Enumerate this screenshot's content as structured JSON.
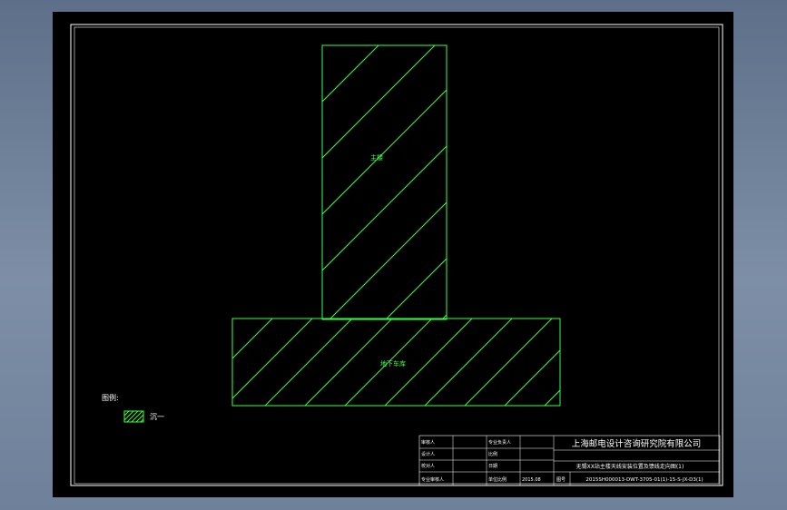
{
  "diagram": {
    "zones": [
      {
        "id": "tower",
        "label": "主楼"
      },
      {
        "id": "basement",
        "label": "地下车库"
      }
    ],
    "legend": {
      "title": "图例:",
      "item_label": "沉一"
    }
  },
  "title_block": {
    "company": "上海邮电设计咨询研究院有限公司",
    "drawing_title": "无锡XX站主楼天线安装位置及馈线走向图(1)",
    "drawing_number": "2015SH000013-DWT-3705-01(1)-15-S-JX-D3(1)",
    "rows": [
      {
        "role": "审核人",
        "mid": "专业负责人"
      },
      {
        "role": "设计人",
        "mid": "比例"
      },
      {
        "role": "校对人",
        "mid": "日期"
      },
      {
        "role": "专业审核人",
        "mid": "单位比例"
      }
    ],
    "date_value": "2015.08",
    "figure_no_label": "图号"
  },
  "colors": {
    "background": "#000000",
    "frame": "#ffffff",
    "geometry": "#3cff3c",
    "window_bg": "#6f819a"
  }
}
